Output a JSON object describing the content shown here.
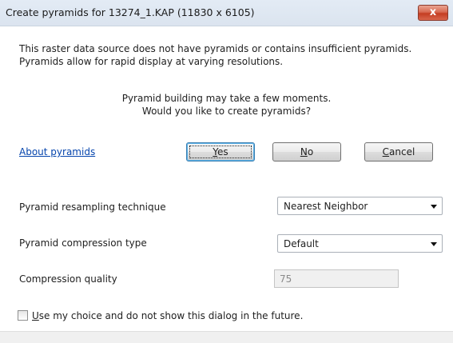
{
  "window": {
    "title": "Create pyramids for 13274_1.KAP (11830 x 6105)",
    "close_glyph": "x"
  },
  "message": {
    "line1": "This raster data source does not have pyramids or contains insufficient pyramids.",
    "line2": "Pyramids allow for rapid display at varying resolutions.",
    "line3": "Pyramid building may take a few moments.",
    "line4": "Would you like to create pyramids?"
  },
  "link": {
    "about": "About pyramids"
  },
  "buttons": {
    "yes": {
      "mnemonic": "Y",
      "rest": "es"
    },
    "no": {
      "mnemonic": "N",
      "rest": "o"
    },
    "cancel": {
      "mnemonic": "C",
      "rest": "ancel"
    }
  },
  "options": {
    "resampling": {
      "label": "Pyramid resampling technique",
      "value": "Nearest Neighbor"
    },
    "compression": {
      "label": "Pyramid compression type",
      "value": "Default"
    },
    "quality": {
      "label": "Compression quality",
      "value": "75"
    }
  },
  "checkbox": {
    "mnemonic": "U",
    "rest": "se my choice and do not show this dialog in the future.",
    "checked": false
  },
  "colors": {
    "link": "#0645ad",
    "close_button": "#c43d22",
    "title_bar": "#dbe4ef"
  }
}
